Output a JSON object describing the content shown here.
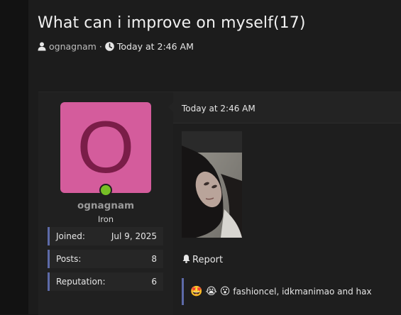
{
  "thread": {
    "title": "What can i improve on myself(17)",
    "author": "ognagnam",
    "separator": "·",
    "time": "Today at 2:46 AM",
    "icons": {
      "author": "user-icon",
      "time": "clock-icon"
    }
  },
  "post": {
    "user": {
      "avatar_letter": "O",
      "avatar_color": "#d45c9c",
      "online": true,
      "name": "ognagnam",
      "rank": "Iron",
      "stats": [
        {
          "label": "Joined:",
          "value": "Jul 9, 2025"
        },
        {
          "label": "Posts:",
          "value": "8"
        },
        {
          "label": "Reputation:",
          "value": "6"
        }
      ]
    },
    "time": "Today at 2:46 AM",
    "report_label": "Report",
    "reactions": {
      "emojis": [
        "🤩",
        "😭",
        "😮"
      ],
      "text": "fashioncel, idkmanimao and hax"
    }
  },
  "colors": {
    "accent": "#5d6aa8",
    "online": "#76bf26",
    "background": "#1c1c1c"
  }
}
